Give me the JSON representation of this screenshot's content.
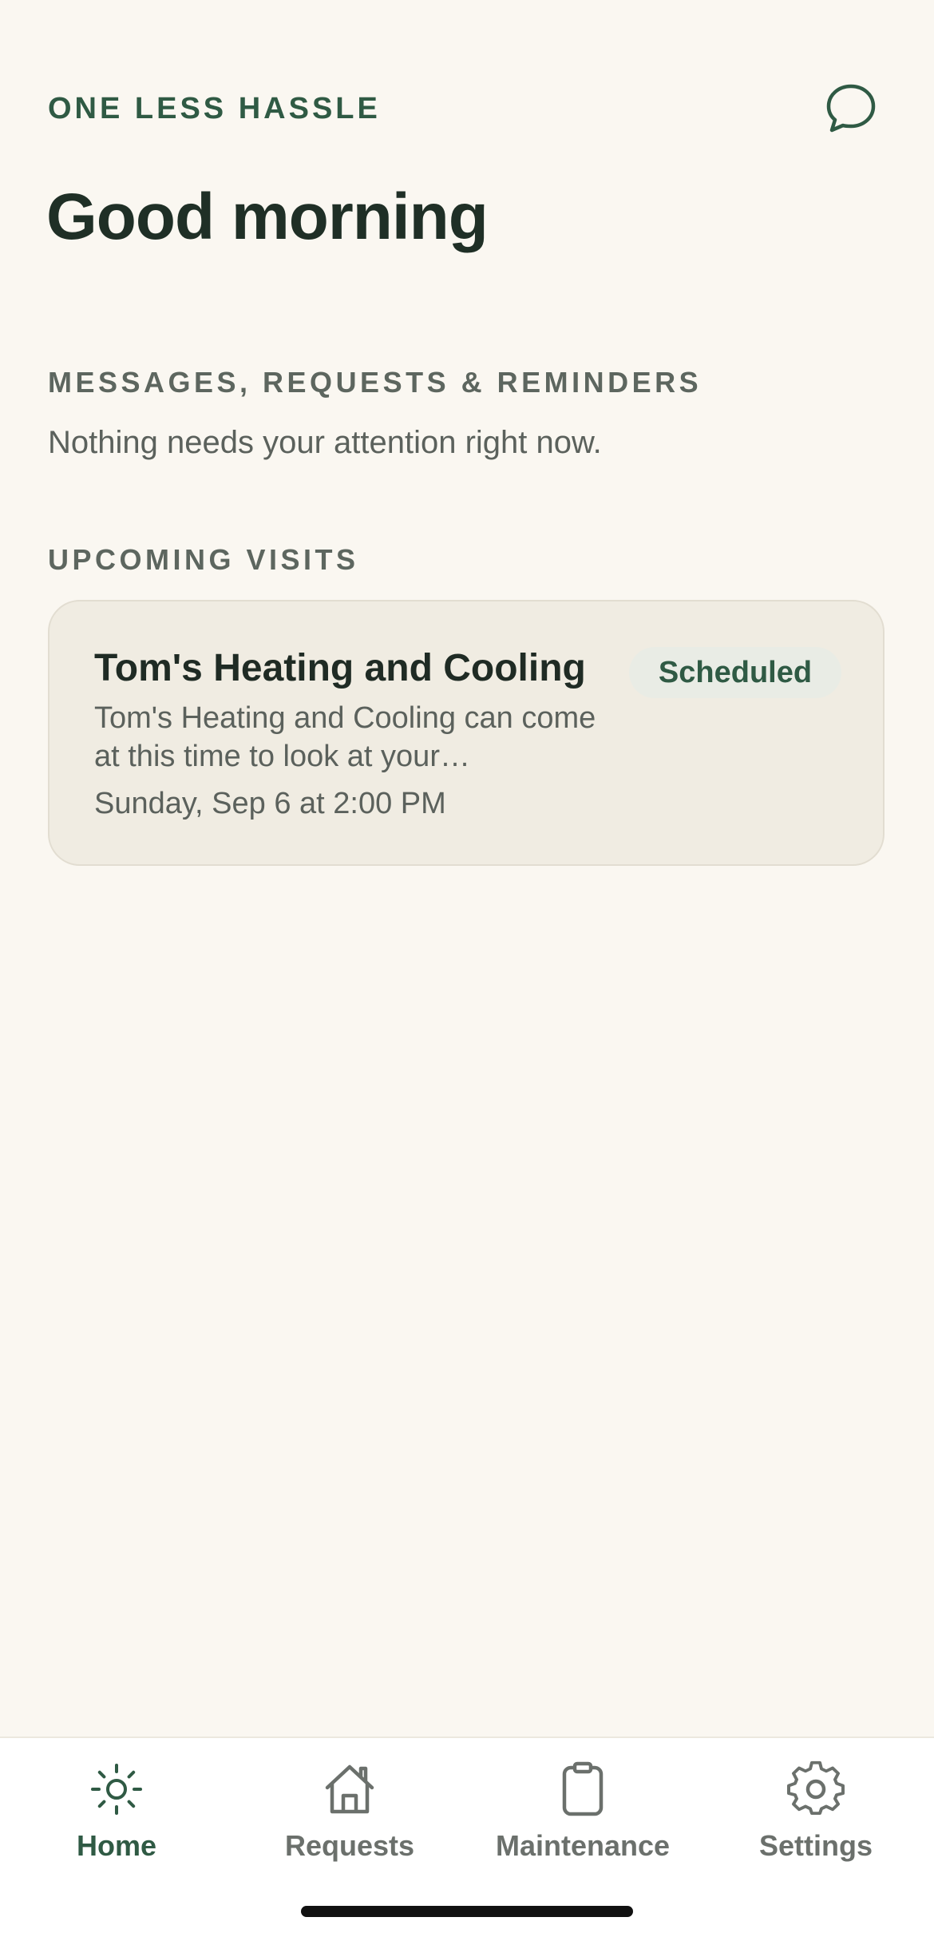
{
  "header": {
    "brand": "ONE LESS HASSLE",
    "greeting": "Good morning",
    "chat_icon": "chat-bubble-icon"
  },
  "messages_section": {
    "label": "MESSAGES, REQUESTS & REMINDERS",
    "empty_text": "Nothing needs your attention right now."
  },
  "visits_section": {
    "label": "UPCOMING VISITS",
    "items": [
      {
        "provider": "Tom's Heating and Cooling",
        "description": "Tom's Heating and Cooling can come at this time to look at your…",
        "datetime": "Sunday, Sep 6 at 2:00 PM",
        "status": "Scheduled"
      }
    ]
  },
  "tabbar": {
    "items": [
      {
        "label": "Home",
        "icon": "sun-icon",
        "active": true
      },
      {
        "label": "Requests",
        "icon": "house-icon",
        "active": false
      },
      {
        "label": "Maintenance",
        "icon": "clipboard-icon",
        "active": false
      },
      {
        "label": "Settings",
        "icon": "gear-icon",
        "active": false
      }
    ]
  },
  "colors": {
    "background": "#faf7f1",
    "accent": "#2f5a44",
    "card": "#f0ece2",
    "badge_bg": "#e9ece5",
    "muted_text": "#5b615c"
  }
}
